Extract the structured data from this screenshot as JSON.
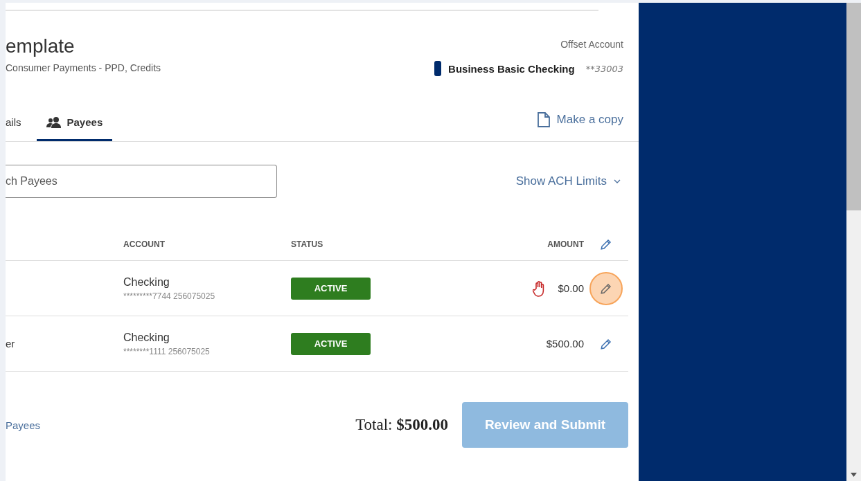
{
  "header": {
    "title": "emplate",
    "subtitle": "Consumer Payments - PPD, Credits",
    "offset_label": "Offset Account",
    "offset_account": {
      "name": "Business Basic Checking",
      "number": "**33003"
    }
  },
  "tabs": [
    {
      "label": "ails",
      "selected": false
    },
    {
      "label": "Payees",
      "selected": true
    }
  ],
  "copy_link": "Make a copy",
  "search": {
    "placeholder": "ch Payees"
  },
  "limits_toggle": "Show ACH Limits",
  "table": {
    "columns": [
      "ACCOUNT",
      "STATUS",
      "AMOUNT"
    ],
    "rows": [
      {
        "name": "",
        "account": "Checking",
        "account_number": "*********7744 256075025",
        "status": "ACTIVE",
        "hold": true,
        "amount": "$0.00",
        "highlighted": true
      },
      {
        "name": "er",
        "account": "Checking",
        "account_number": "********1111 256075025",
        "status": "ACTIVE",
        "hold": false,
        "amount": "$500.00",
        "highlighted": false
      }
    ]
  },
  "footer": {
    "link": "Payees",
    "total": "Total: **$500.00**",
    "submit": {
      "label": "Review and Submit",
      "disabled": true
    }
  }
}
